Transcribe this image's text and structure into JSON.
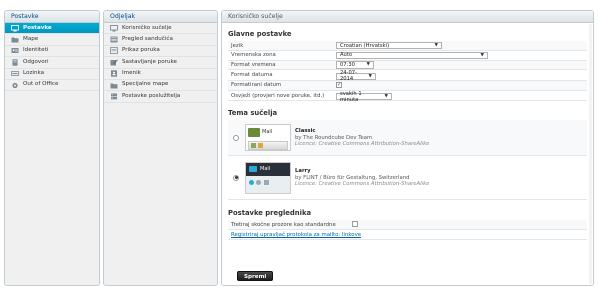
{
  "col1": {
    "title": "Postavke",
    "items": [
      {
        "label": "Postavke",
        "icon": "monitor-icon",
        "active": true
      },
      {
        "label": "Mape",
        "icon": "folder-icon"
      },
      {
        "label": "Identiteti",
        "icon": "identity-card-icon"
      },
      {
        "label": "Odgovori",
        "icon": "reply-document-icon"
      },
      {
        "label": "Lozinka",
        "icon": "password-icon"
      },
      {
        "label": "Out of Office",
        "icon": "gear-icon"
      }
    ]
  },
  "col2": {
    "title": "Odjeljak",
    "items": [
      {
        "label": "Korisničko sučelje",
        "icon": "monitor-icon"
      },
      {
        "label": "Pregled sandučića",
        "icon": "mailbox-view-icon"
      },
      {
        "label": "Prikaz poruka",
        "icon": "message-view-icon"
      },
      {
        "label": "Sastavljanje poruke",
        "icon": "compose-icon"
      },
      {
        "label": "Imenik",
        "icon": "addressbook-icon"
      },
      {
        "label": "Specijalne mape",
        "icon": "special-folder-icon"
      },
      {
        "label": "Postavke poslužitelja",
        "icon": "server-icon"
      }
    ]
  },
  "main": {
    "title": "Korisničko sučelje",
    "general": {
      "title": "Glavne postavke",
      "rows": [
        {
          "label": "Jezik",
          "value": "Croatian (Hrvatski)"
        },
        {
          "label": "Vremenska zona",
          "value": "Auto"
        },
        {
          "label": "Format vremena",
          "value": "07:30"
        },
        {
          "label": "Format datuma",
          "value": "24-07-2014"
        },
        {
          "label": "Formatirani datum",
          "checked": "✓"
        },
        {
          "label": "Osvježi (provjeri nove poruke, itd.)",
          "value": "svakih 1 minuta"
        }
      ]
    },
    "theme": {
      "title": "Tema sučelja",
      "skins": [
        {
          "name": "Classic",
          "author": "by The Roundcube Dev Team",
          "license": "Licence: Creative Commons Attribution-ShareAlike",
          "thumb_label": "Mail",
          "selected": false
        },
        {
          "name": "Larry",
          "author": "by FLINT / Büro für Gestaltung, Switzerland",
          "license": "Licence: Creative Commons Attribution-ShareAlike",
          "thumb_label": "Mail",
          "selected": true
        }
      ]
    },
    "browser": {
      "title": "Postavke preglednika",
      "default_label": "Tretiraj skočne prozore kao standardne",
      "protocol_link": "Registriraj upravljač protokola za mailto: linkove"
    },
    "save_label": "Spremi"
  },
  "colors": {
    "accent": "#00a5cc",
    "link": "#0069a6",
    "header_text": "#004c86"
  }
}
